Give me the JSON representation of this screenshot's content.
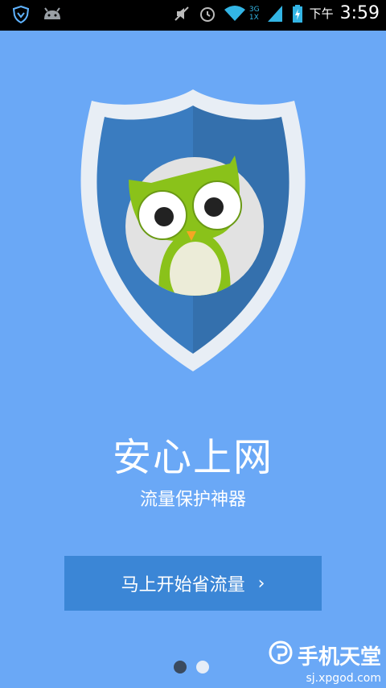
{
  "status_bar": {
    "time": "3:59",
    "ampm": "下午",
    "network_3g": "3G",
    "network_1x": "1X",
    "icons": [
      "shield-icon",
      "android-icon",
      "mute-icon",
      "alarm-icon",
      "wifi-icon",
      "signal-icon",
      "battery-charging-icon"
    ]
  },
  "hero": {
    "title": "安心上网",
    "subtitle": "流量保护神器"
  },
  "cta": {
    "label": "马上开始省流量",
    "chevron": "›"
  },
  "pager": {
    "current": 1,
    "total": 2
  },
  "watermark": {
    "text": "手机天堂",
    "url": "sj.xpgod.com"
  },
  "colors": {
    "background": "#6aa8f6",
    "button": "#3b86d6",
    "shield_dark": "#3a78b8",
    "owl_green": "#8ac21a"
  }
}
